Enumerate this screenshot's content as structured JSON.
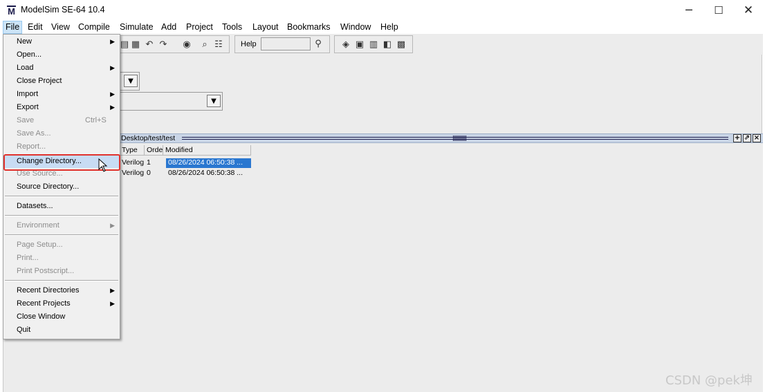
{
  "window": {
    "logo_letter": "M",
    "title": "ModelSim SE-64 10.4",
    "minimize": "─",
    "maximize": "☐",
    "close": "✕"
  },
  "menubar": [
    "File",
    "Edit",
    "View",
    "Compile",
    "Simulate",
    "Add",
    "Project",
    "Tools",
    "Layout",
    "Bookmarks",
    "Window",
    "Help"
  ],
  "toolbar": {
    "help_label": "Help",
    "help_value": ""
  },
  "project_pane": {
    "path": "Desktop/test/test",
    "columns": [
      "Type",
      "Order",
      "Modified"
    ],
    "rows": [
      {
        "type": "Verilog",
        "order": "1",
        "modified": "08/26/2024 06:50:38 ...",
        "selected": true
      },
      {
        "type": "Verilog",
        "order": "0",
        "modified": "08/26/2024 06:50:38 ...",
        "selected": false
      }
    ]
  },
  "file_menu": {
    "items": [
      {
        "label": "New",
        "submenu": true
      },
      {
        "label": "Open..."
      },
      {
        "label": "Load",
        "submenu": true
      },
      {
        "label": "Close Project"
      },
      {
        "label": "Import",
        "submenu": true
      },
      {
        "label": "Export",
        "submenu": true
      },
      {
        "label": "Save",
        "shortcut": "Ctrl+S",
        "disabled": true
      },
      {
        "label": "Save As...",
        "disabled": true
      },
      {
        "label": "Report...",
        "disabled": true
      },
      {
        "label": "Change Directory...",
        "highlighted": true
      },
      {
        "label": "Use Source...",
        "disabled": true
      },
      {
        "label": "Source Directory..."
      },
      {
        "label": "Datasets..."
      },
      {
        "label": "Environment",
        "submenu": true,
        "disabled": true
      },
      {
        "label": "Page Setup...",
        "disabled": true
      },
      {
        "label": "Print...",
        "disabled": true
      },
      {
        "label": "Print Postscript...",
        "disabled": true
      },
      {
        "label": "Recent Directories",
        "submenu": true
      },
      {
        "label": "Recent Projects",
        "submenu": true
      },
      {
        "label": "Close Window"
      },
      {
        "label": "Quit"
      }
    ]
  },
  "watermark": "CSDN @pek坤",
  "colors": {
    "selection": "#2a77d0",
    "highlight_box": "#e0322d",
    "pane_header": "#c9d5e6"
  }
}
